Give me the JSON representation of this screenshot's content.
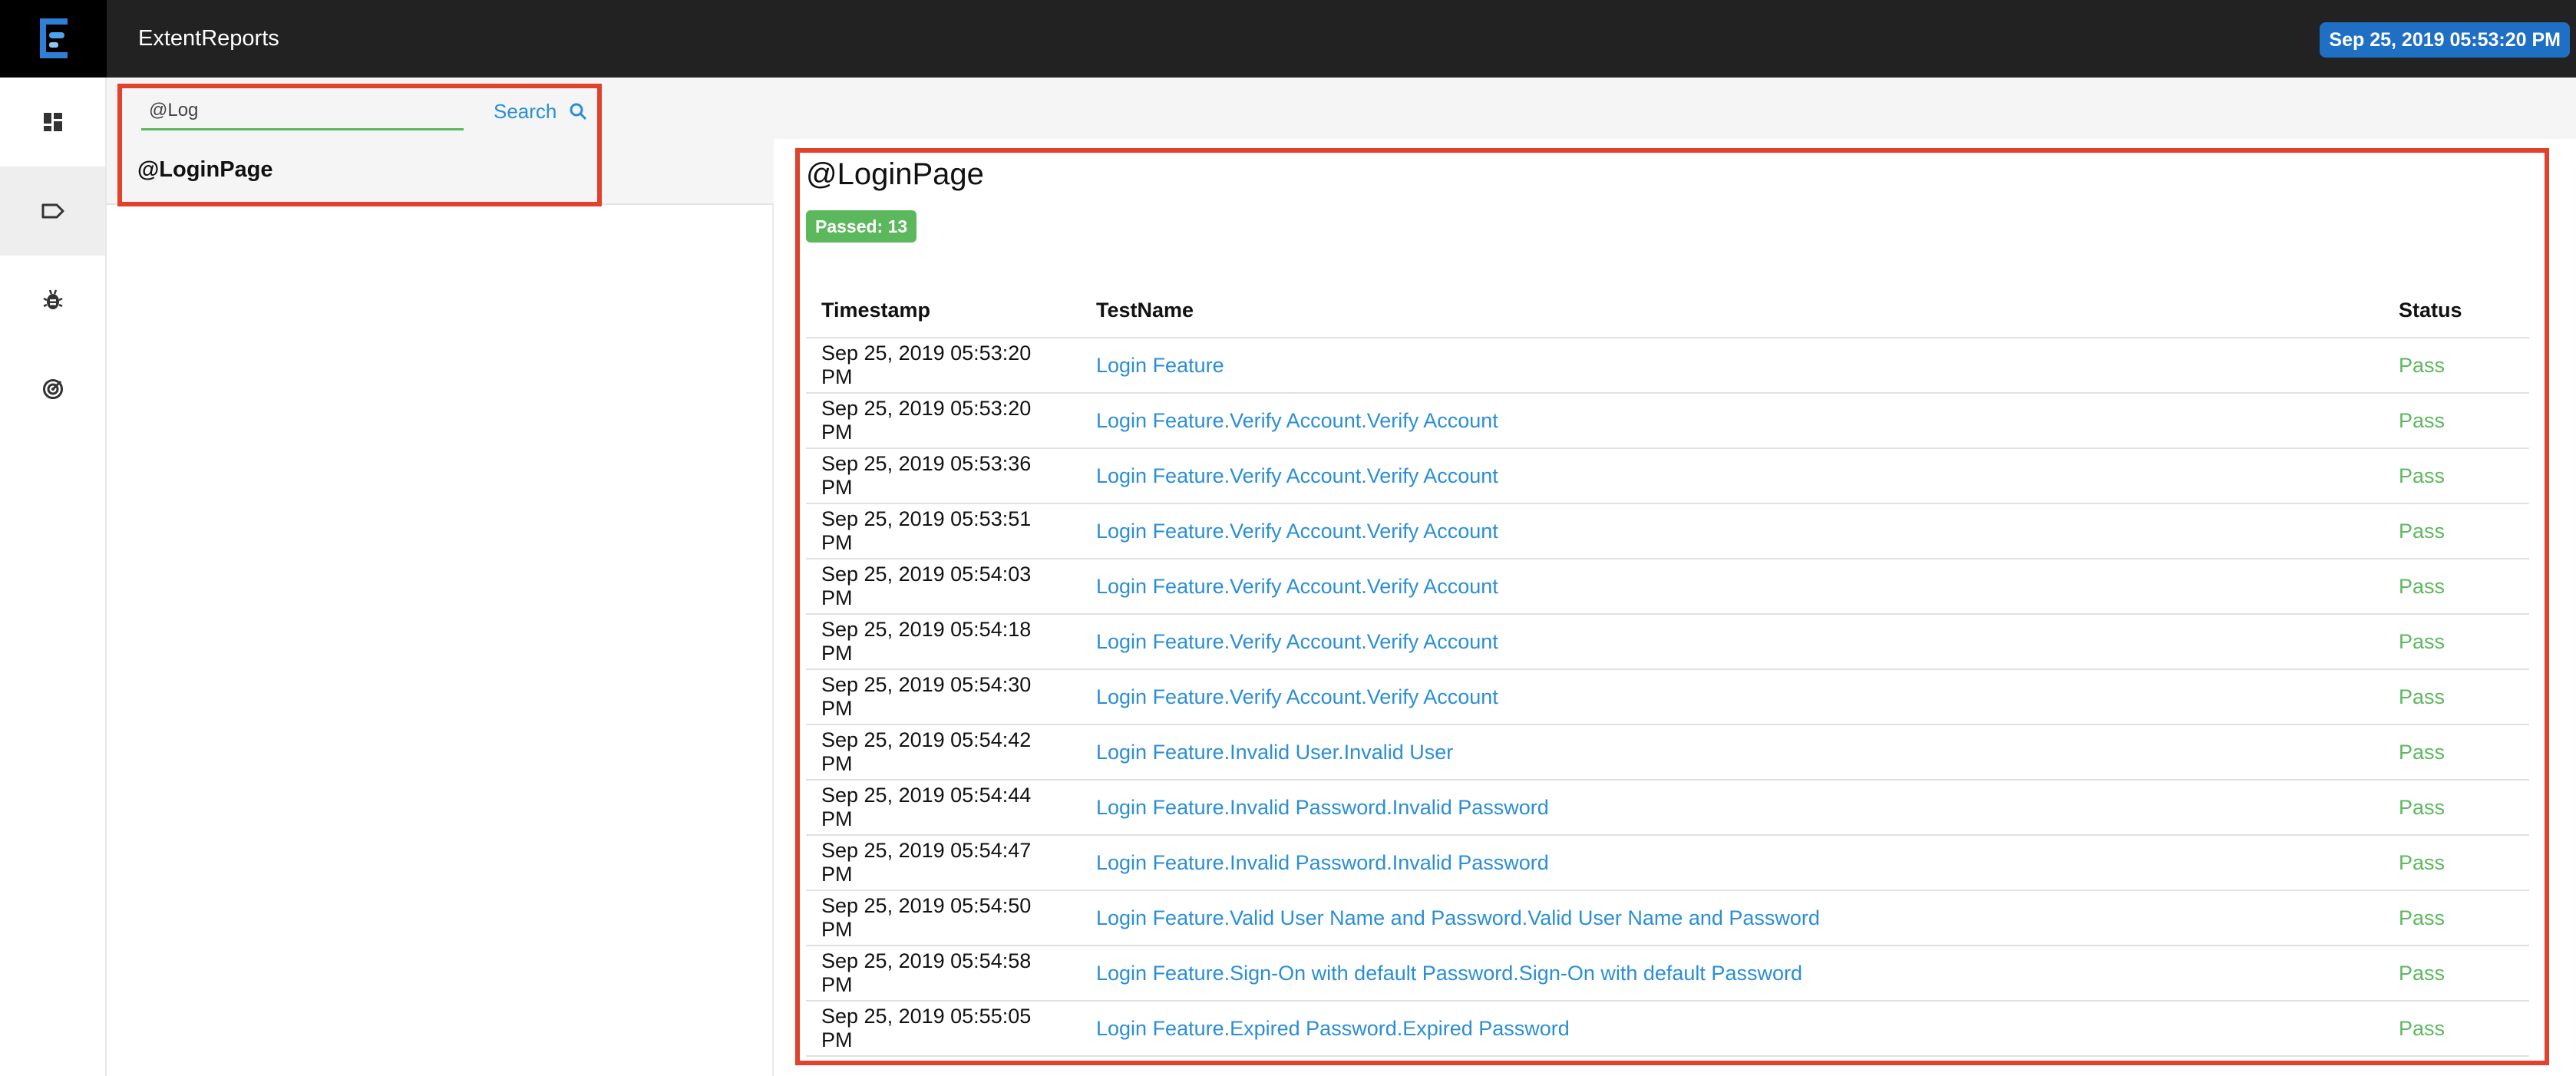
{
  "app": {
    "brand": "ExtentReports",
    "report_date": "Sep 25, 2019 05:53:20 PM"
  },
  "sidebar": {
    "items": [
      {
        "icon": "dashboard-icon"
      },
      {
        "icon": "tag-icon",
        "active": true
      },
      {
        "icon": "bug-icon"
      },
      {
        "icon": "radar-icon"
      }
    ]
  },
  "search": {
    "value": "@Log",
    "button_label": "Search",
    "icon": "search-icon"
  },
  "tag_list": [
    {
      "label": "@LoginPage"
    }
  ],
  "detail": {
    "title": "@LoginPage",
    "passed_badge": "Passed: 13",
    "columns": {
      "timestamp": "Timestamp",
      "test_name": "TestName",
      "status": "Status"
    },
    "rows": [
      {
        "timestamp": "Sep 25, 2019 05:53:20 PM",
        "test_name": "Login Feature",
        "status": "Pass"
      },
      {
        "timestamp": "Sep 25, 2019 05:53:20 PM",
        "test_name": "Login Feature.Verify Account.Verify Account",
        "status": "Pass"
      },
      {
        "timestamp": "Sep 25, 2019 05:53:36 PM",
        "test_name": "Login Feature.Verify Account.Verify Account",
        "status": "Pass"
      },
      {
        "timestamp": "Sep 25, 2019 05:53:51 PM",
        "test_name": "Login Feature.Verify Account.Verify Account",
        "status": "Pass"
      },
      {
        "timestamp": "Sep 25, 2019 05:54:03 PM",
        "test_name": "Login Feature.Verify Account.Verify Account",
        "status": "Pass"
      },
      {
        "timestamp": "Sep 25, 2019 05:54:18 PM",
        "test_name": "Login Feature.Verify Account.Verify Account",
        "status": "Pass"
      },
      {
        "timestamp": "Sep 25, 2019 05:54:30 PM",
        "test_name": "Login Feature.Verify Account.Verify Account",
        "status": "Pass"
      },
      {
        "timestamp": "Sep 25, 2019 05:54:42 PM",
        "test_name": "Login Feature.Invalid User.Invalid User",
        "status": "Pass"
      },
      {
        "timestamp": "Sep 25, 2019 05:54:44 PM",
        "test_name": "Login Feature.Invalid Password.Invalid Password",
        "status": "Pass"
      },
      {
        "timestamp": "Sep 25, 2019 05:54:47 PM",
        "test_name": "Login Feature.Invalid Password.Invalid Password",
        "status": "Pass"
      },
      {
        "timestamp": "Sep 25, 2019 05:54:50 PM",
        "test_name": "Login Feature.Valid User Name and Password.Valid User Name and Password",
        "status": "Pass"
      },
      {
        "timestamp": "Sep 25, 2019 05:54:58 PM",
        "test_name": "Login Feature.Sign-On with default Password.Sign-On with default Password",
        "status": "Pass"
      },
      {
        "timestamp": "Sep 25, 2019 05:55:05 PM",
        "test_name": "Login Feature.Expired Password.Expired Password",
        "status": "Pass"
      }
    ]
  },
  "colors": {
    "topbar": "#222222",
    "accent_blue": "#2a8ed6",
    "pass_green": "#5cb85c",
    "highlight_red": "#e2412b"
  }
}
